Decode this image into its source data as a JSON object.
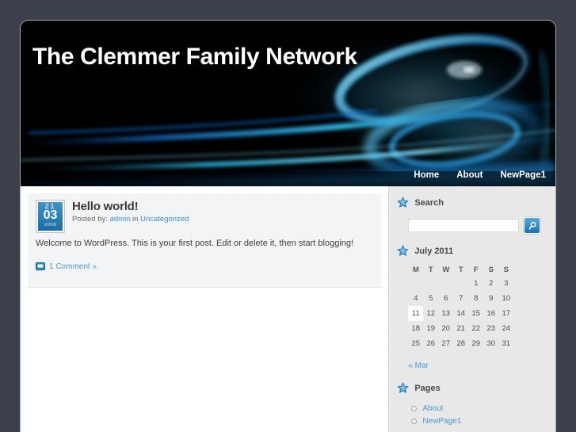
{
  "site": {
    "title": "The Clemmer Family Network"
  },
  "nav": {
    "items": [
      {
        "label": "Home"
      },
      {
        "label": "About"
      },
      {
        "label": "NewPage1"
      }
    ]
  },
  "post": {
    "date": {
      "day_top": "21",
      "day": "03",
      "year": "2008"
    },
    "title": "Hello world!",
    "meta_prefix": "Posted by:",
    "author": "admin",
    "meta_in": "in",
    "category": "Uncategorized",
    "excerpt": "Welcome to WordPress. This is your first post. Edit or delete it, then start blogging!",
    "comment_label": "1 Comment »"
  },
  "sidebar": {
    "search": {
      "title": "Search",
      "value": "",
      "placeholder": "",
      "button_icon": "magnifier-icon"
    },
    "calendar": {
      "title": "July 2011",
      "weekdays": [
        "M",
        "T",
        "W",
        "T",
        "F",
        "S",
        "S"
      ],
      "weeks": [
        [
          "",
          "",
          "",
          "",
          "1",
          "2",
          "3"
        ],
        [
          "4",
          "5",
          "6",
          "7",
          "8",
          "9",
          "10"
        ],
        [
          "11",
          "12",
          "13",
          "14",
          "15",
          "16",
          "17"
        ],
        [
          "18",
          "19",
          "20",
          "21",
          "22",
          "23",
          "24"
        ],
        [
          "25",
          "26",
          "27",
          "28",
          "29",
          "30",
          "31"
        ]
      ],
      "today": "11",
      "prev_link": "« Mar"
    },
    "pages": {
      "title": "Pages",
      "items": [
        {
          "label": "About"
        },
        {
          "label": "NewPage1"
        }
      ]
    }
  },
  "colors": {
    "page_bg": "#3c404a",
    "banner_bg": "#000000",
    "accent_blue": "#4b9ad4",
    "sidebar_bg": "#e8e8e8"
  }
}
